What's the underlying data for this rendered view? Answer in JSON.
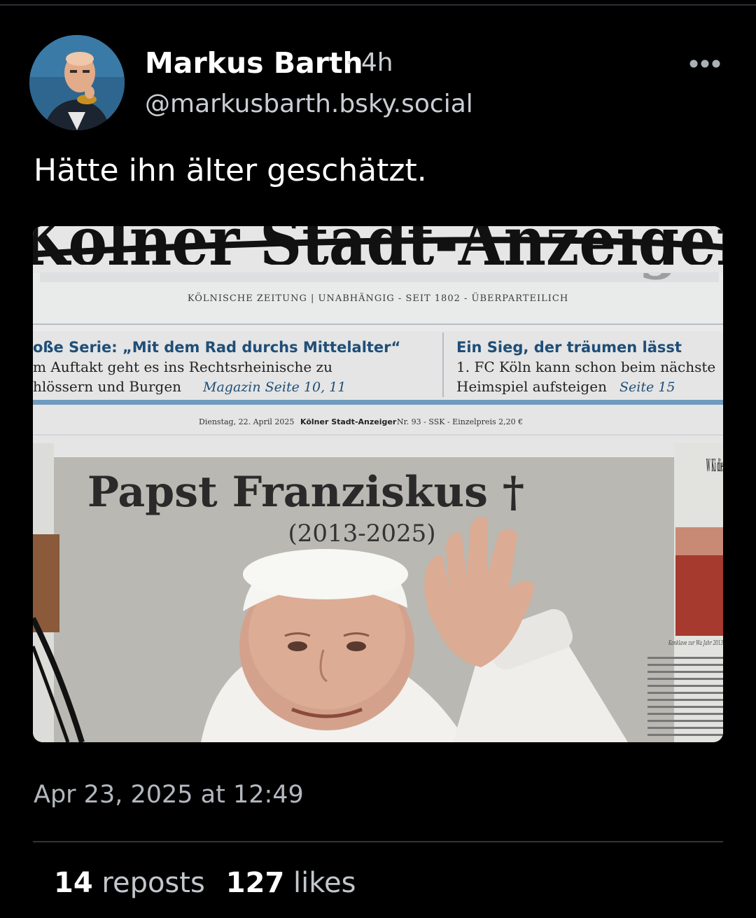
{
  "post": {
    "author_name": "Markus Barth",
    "time_ago": "· 4h",
    "handle": "@markusbarth.bsky.social",
    "text": "Hätte ihn älter geschätzt.",
    "timestamp": "Apr 23, 2025 at 12:49",
    "reposts_count": "14",
    "reposts_label": "reposts",
    "likes_count": "127",
    "likes_label": "likes",
    "more_icon": "ellipsis-icon"
  },
  "newspaper": {
    "masthead": "Kölner Stadt-Anzeiger",
    "motto": "KÖLNISCHE ZEITUNG | UNABHÄNGIG - SEIT 1802 - ÜBERPARTEILICH",
    "teaser_left_head": "oße Serie: „Mit dem Rad durchs Mittelalter“",
    "teaser_left_line1": "m Auftakt geht es ins Rechtsrheinische zu",
    "teaser_left_line2": "hlössern und Burgen",
    "teaser_left_ref": "Magazin Seite 10, 11",
    "teaser_right_head": "Ein Sieg, der träumen lässt",
    "teaser_right_line1": "1. FC Köln kann schon beim nächste",
    "teaser_right_line2": "Heimspiel aufsteigen",
    "teaser_right_ref": "Seite 15",
    "dateline_date": "Dienstag, 22. April 2025",
    "dateline_paper": "Kölner Stadt-Anzeiger",
    "dateline_info": "Nr. 93 - SSK - Einzelpreis 2,20 €",
    "headline": "Papst Franziskus †",
    "subheadline": "(2013-2025)",
    "side_head": "W Ki die",
    "side_caption": "Konklave zur Wa Jahr 2013"
  },
  "colors": {
    "background": "#000000",
    "name": "#ffffff",
    "muted": "#c9ced4",
    "divider": "#30353b"
  }
}
